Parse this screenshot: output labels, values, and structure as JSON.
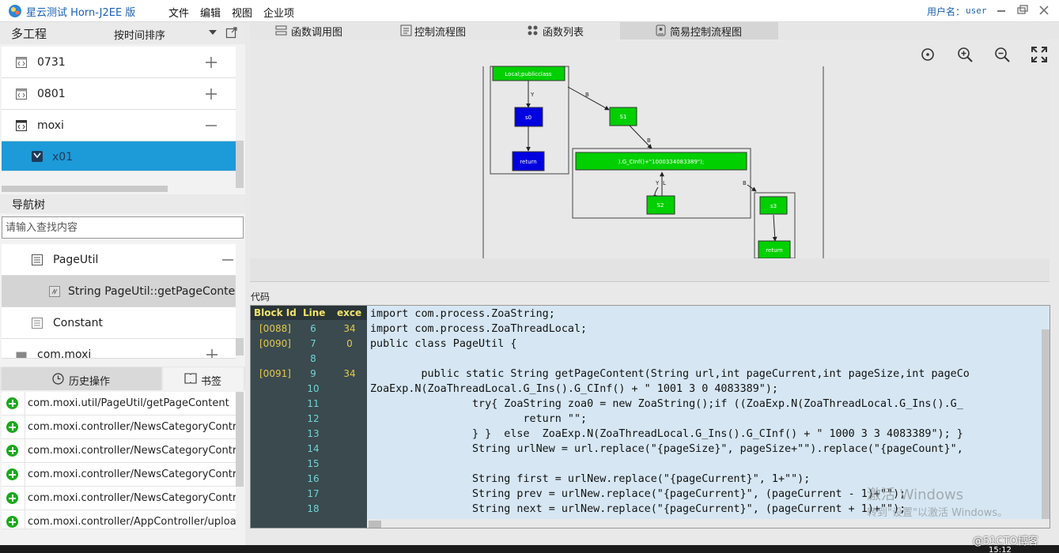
{
  "titlebar": {
    "app_title": "星云测试 Horn-J2EE 版",
    "menus": [
      "文件",
      "编辑",
      "视图",
      "企业项"
    ],
    "user_label": "用户名：",
    "user_name": "user"
  },
  "project_panel": {
    "title": "多工程",
    "sort_label": "按时间排序",
    "items": [
      {
        "label": "0731",
        "control": "plus"
      },
      {
        "label": "0801",
        "control": "plus"
      },
      {
        "label": "moxi",
        "control": "minus"
      },
      {
        "label": "x01",
        "control": "none",
        "selected": true
      }
    ]
  },
  "nav_tree": {
    "title": "导航树",
    "search_placeholder": "请输入查找内容",
    "items": [
      {
        "label": "PageUtil"
      },
      {
        "label": "String PageUtil::getPageContent(St"
      },
      {
        "label": "Constant"
      },
      {
        "label": "com.moxi"
      }
    ]
  },
  "history": {
    "tab_history": "历史操作",
    "tab_bookmark": "书签",
    "items": [
      "com.moxi.util/PageUtil/getPageContent",
      "com.moxi.controller/NewsCategoryContro",
      "com.moxi.controller/NewsCategoryContro",
      "com.moxi.controller/NewsCategoryContro",
      "com.moxi.controller/NewsCategoryContro",
      "com.moxi.controller/AppController/upload"
    ]
  },
  "view_tabs": [
    "函数调用图",
    "控制流程图",
    "函数列表",
    "简易控制流程图"
  ],
  "flow_graph": {
    "nodes": {
      "local": "Local;publicclass",
      "s0": "s0",
      "ret1": "return",
      "s1": "S1",
      "expr": ").G_CInf()+\"1000334083389\");",
      "s2": "S2",
      "s3": "s3",
      "ret2": "return"
    },
    "edge_labels": {
      "y1": "Y",
      "b1": "B",
      "b2": "B",
      "y2": "Y",
      "l1": "L",
      "b3": "B"
    },
    "colors": {
      "green": "#00d000",
      "blue": "#0000e0"
    }
  },
  "code": {
    "label": "代码",
    "gutter_headers": [
      "Block Id",
      "Line",
      "exce"
    ],
    "gutter_rows": [
      {
        "block": "[0088]",
        "line": "6",
        "exec": "34"
      },
      {
        "block": "[0090]",
        "line": "7",
        "exec": "0"
      },
      {
        "block": "",
        "line": "8",
        "exec": ""
      },
      {
        "block": "[0091]",
        "line": "9",
        "exec": "34"
      },
      {
        "block": "",
        "line": "10",
        "exec": ""
      },
      {
        "block": "",
        "line": "11",
        "exec": ""
      },
      {
        "block": "",
        "line": "12",
        "exec": ""
      },
      {
        "block": "",
        "line": "13",
        "exec": ""
      },
      {
        "block": "",
        "line": "14",
        "exec": ""
      },
      {
        "block": "",
        "line": "15",
        "exec": ""
      },
      {
        "block": "",
        "line": "16",
        "exec": ""
      },
      {
        "block": "",
        "line": "17",
        "exec": ""
      },
      {
        "block": "",
        "line": "18",
        "exec": ""
      }
    ],
    "lines": [
      "import com.process.ZoaString;",
      "import com.process.ZoaThreadLocal;",
      "public class PageUtil {",
      "",
      "        public static String getPageContent(String url,int pageCurrent,int pageSize,int pageCo",
      "ZoaExp.N(ZoaThreadLocal.G_Ins().G_CInf() + \" 1001 3 0 4083389\");",
      "                try{ ZoaString zoa0 = new ZoaString();if ((ZoaExp.N(ZoaThreadLocal.G_Ins().G_",
      "                        return \"\";",
      "                } }  else  ZoaExp.N(ZoaThreadLocal.G_Ins().G_CInf() + \" 1000 3 3 4083389\"); }",
      "                String urlNew = url.replace(\"{pageSize}\", pageSize+\"\").replace(\"{pageCount}\",",
      "",
      "                String first = urlNew.replace(\"{pageCurrent}\", 1+\"\");",
      "                String prev = urlNew.replace(\"{pageCurrent}\", (pageCurrent - 1)+\"\");",
      "                String next = urlNew.replace(\"{pageCurrent}\", (pageCurrent + 1)+\"\");"
    ]
  },
  "watermark": {
    "line1": "激活 Windows",
    "line2": "转到\"设置\"以激活 Windows。"
  },
  "taskbar": {
    "site_mark": "@51CTO博客",
    "clock": "15:12"
  }
}
